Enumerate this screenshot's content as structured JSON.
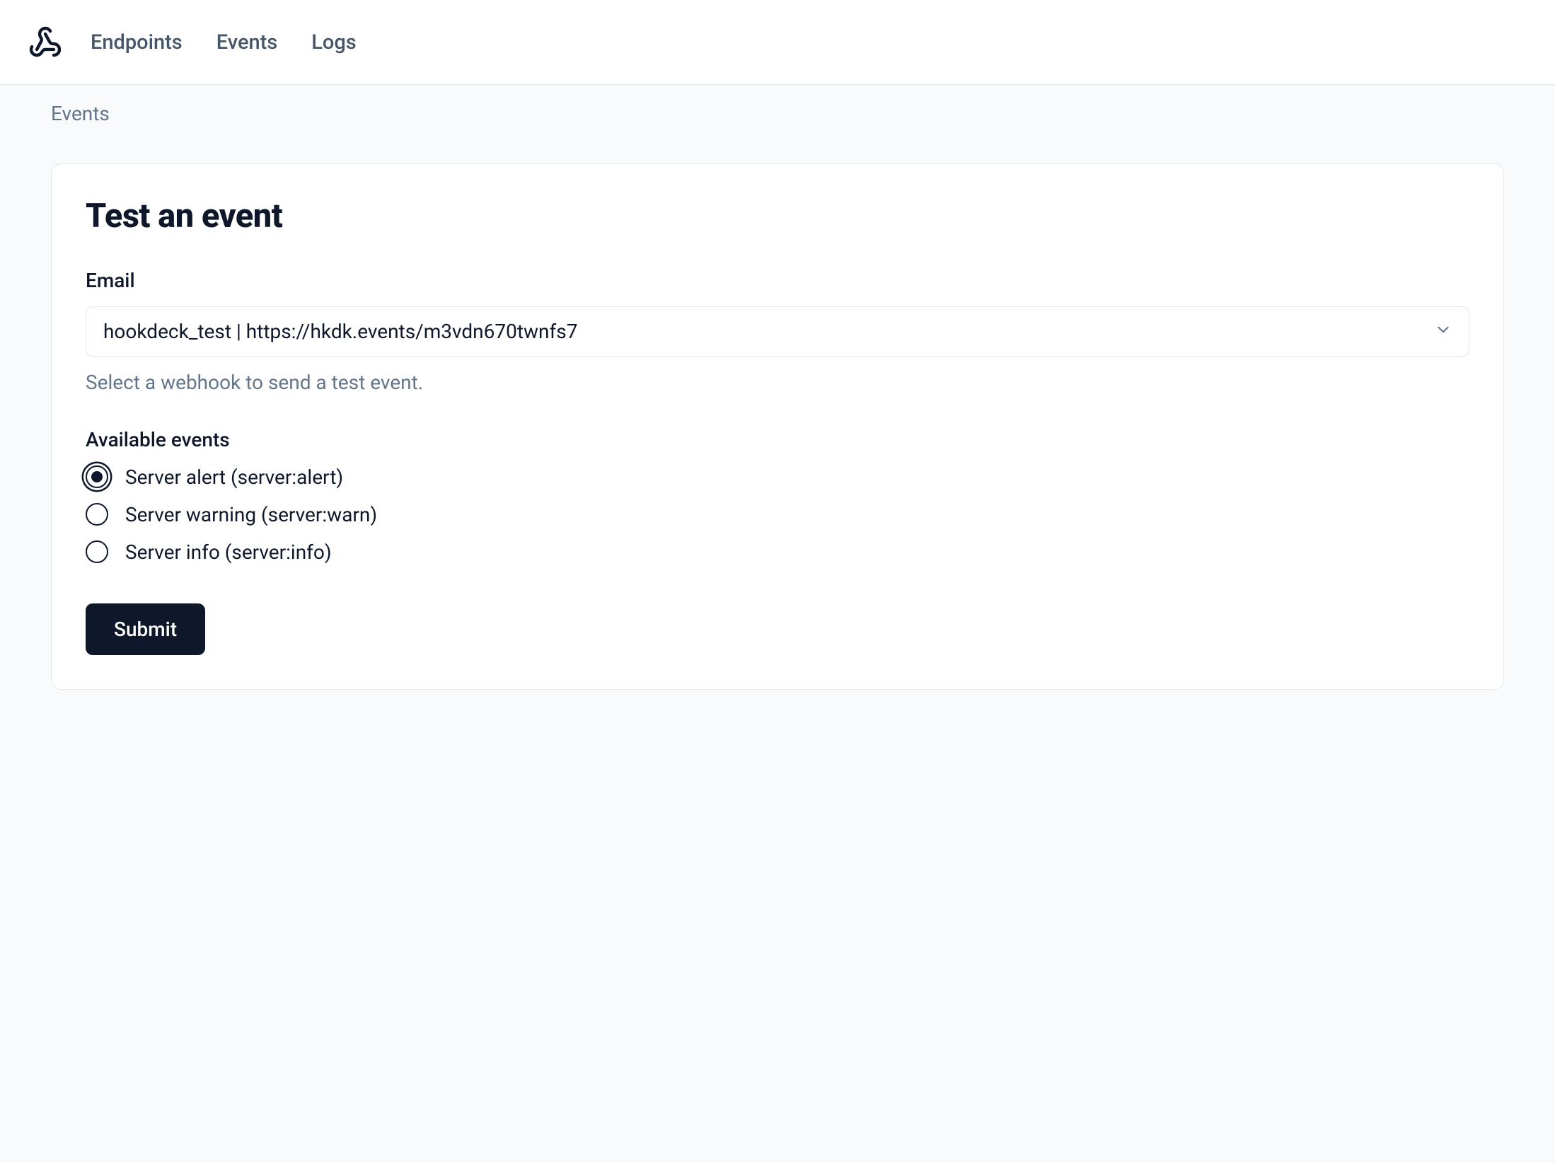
{
  "nav": {
    "items": [
      {
        "label": "Endpoints"
      },
      {
        "label": "Events"
      },
      {
        "label": "Logs"
      }
    ]
  },
  "breadcrumb": "Events",
  "card": {
    "title": "Test an event",
    "emailLabel": "Email",
    "emailSelected": "hookdeck_test | https://hkdk.events/m3vdn670twnfs7",
    "helperText": "Select a webhook to send a test event.",
    "eventsLabel": "Available events",
    "events": [
      {
        "label": "Server alert (server:alert)",
        "selected": true
      },
      {
        "label": "Server warning (server:warn)",
        "selected": false
      },
      {
        "label": "Server info (server:info)",
        "selected": false
      }
    ],
    "submitLabel": "Submit"
  }
}
